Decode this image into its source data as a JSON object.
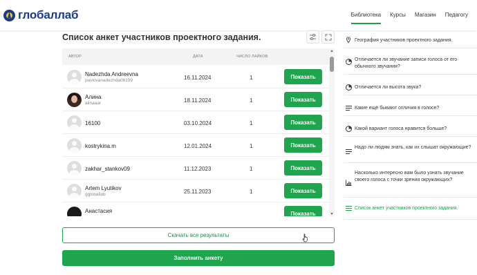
{
  "header": {
    "logo_text": "глобаллаб",
    "nav": [
      {
        "label": "Библиотека",
        "active": true
      },
      {
        "label": "Курсы",
        "active": false
      },
      {
        "label": "Магазин",
        "active": false
      },
      {
        "label": "Педагогу",
        "active": false
      }
    ]
  },
  "main": {
    "title": "Список анкет участников проектного задания.",
    "table": {
      "columns": {
        "author": "Автор",
        "date": "Дата",
        "likes": "Число лайков"
      },
      "rows": [
        {
          "name": "Nadezhda Andreevna",
          "login": "pavlovanadezhda06199",
          "date": "16.11.2024",
          "likes": "1",
          "action": "Показать",
          "avatar": "placeholder"
        },
        {
          "name": "Алина",
          "login": "alinaaar",
          "date": "18.11.2024",
          "likes": "1",
          "action": "Показать",
          "avatar": "photo"
        },
        {
          "name": "16100",
          "login": "",
          "date": "03.10.2024",
          "likes": "1",
          "action": "Показать",
          "avatar": "placeholder"
        },
        {
          "name": "kostrykina.m",
          "login": "",
          "date": "12.01.2024",
          "likes": "1",
          "action": "Показать",
          "avatar": "placeholder"
        },
        {
          "name": "zakhar_stankov09",
          "login": "",
          "date": "11.12.2023",
          "likes": "1",
          "action": "Показать",
          "avatar": "placeholder"
        },
        {
          "name": "Artem Lyutikov",
          "login": "ggloballab",
          "date": "25.11.2023",
          "likes": "1",
          "action": "Показать",
          "avatar": "placeholder"
        },
        {
          "name": "Анастасия",
          "login": "",
          "date": "",
          "likes": "",
          "action": "Показать",
          "avatar": "dark"
        }
      ]
    },
    "download_label": "Скачать все результаты",
    "fill_label": "Заполнить анкету"
  },
  "sidebar": {
    "items": [
      {
        "label": "География участников проектного задания.",
        "icon": "map-pin-icon",
        "active": false
      },
      {
        "label": "Отличается ли звучание записи голоса от его обычного звучания?",
        "icon": "pie-chart-icon",
        "active": false
      },
      {
        "label": "Отличается ли высота звука?",
        "icon": "pie-chart-icon",
        "active": false
      },
      {
        "label": "Какие ещё бывают отличия в голосе?",
        "icon": "text-lines-icon",
        "active": false
      },
      {
        "label": "Какой вариант голоса нравится больше?",
        "icon": "pie-chart-icon",
        "active": false
      },
      {
        "label": "Надо ли людям знать, как их слышат окружающие?",
        "icon": "text-lines-icon",
        "active": false
      },
      {
        "label": "Насколько интересно вам было узнать звучание своего голоса с точки зрения окружающих?",
        "icon": "bar-chart-icon",
        "active": false
      },
      {
        "label": "Список анкет участников проектного задания.",
        "icon": "list-icon",
        "active": true
      }
    ]
  }
}
